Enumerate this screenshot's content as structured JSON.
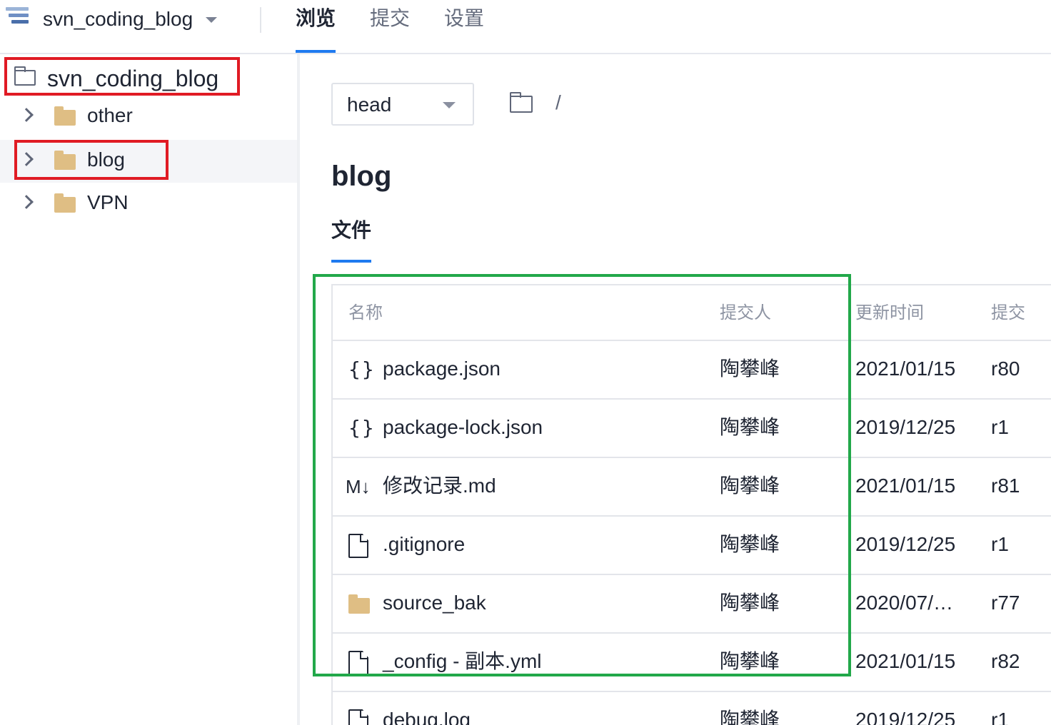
{
  "header": {
    "repo_name": "svn_coding_blog",
    "tabs": [
      {
        "label": "浏览",
        "active": true
      },
      {
        "label": "提交",
        "active": false
      },
      {
        "label": "设置",
        "active": false
      }
    ],
    "accent_color": "#1f7af0"
  },
  "sidebar": {
    "root": {
      "label": "svn_coding_blog",
      "icon": "folder-outline-icon"
    },
    "items": [
      {
        "label": "other",
        "icon": "folder-icon"
      },
      {
        "label": "blog",
        "icon": "folder-icon",
        "selected": true
      },
      {
        "label": "VPN",
        "icon": "folder-icon"
      }
    ]
  },
  "main": {
    "branch": "head",
    "path_separator": "/",
    "title": "blog",
    "section_tab": "文件",
    "table": {
      "headers": {
        "name": "名称",
        "author": "提交人",
        "updated": "更新时间",
        "revision": "提交"
      },
      "rows": [
        {
          "icon": "json-icon",
          "icon_text": "{}",
          "name": "package.json",
          "author": "陶攀峰",
          "date": "2021/01/15",
          "rev": "r80"
        },
        {
          "icon": "json-icon",
          "icon_text": "{}",
          "name": "package-lock.json",
          "author": "陶攀峰",
          "date": "2019/12/25",
          "rev": "r1"
        },
        {
          "icon": "markdown-icon",
          "icon_text": "M↓",
          "name": "修改记录.md",
          "author": "陶攀峰",
          "date": "2021/01/15",
          "rev": "r81"
        },
        {
          "icon": "file-icon",
          "name": ".gitignore",
          "author": "陶攀峰",
          "date": "2019/12/25",
          "rev": "r1"
        },
        {
          "icon": "folder-icon",
          "name": "source_bak",
          "author": "陶攀峰",
          "date": "2020/07/…",
          "rev": "r77"
        },
        {
          "icon": "file-icon",
          "name": "_config - 副本.yml",
          "author": "陶攀峰",
          "date": "2021/01/15",
          "rev": "r82"
        },
        {
          "icon": "file-icon",
          "name": "debug.log",
          "author": "陶攀峰",
          "date": "2019/12/25",
          "rev": "r1"
        }
      ]
    }
  },
  "annotations": {
    "red_box_color": "#e01b24",
    "green_box_color": "#22a84a"
  }
}
